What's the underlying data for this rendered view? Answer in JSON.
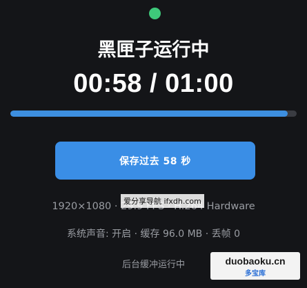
{
  "colors": {
    "background": "#141518",
    "status_dot": "#3ec97a",
    "progress_fill": "#3d8fe0",
    "progress_track": "#3a3c42",
    "button_bg": "#3a8ee6",
    "text_primary": "#ffffff",
    "text_secondary": "#9a9da3"
  },
  "icons": {
    "status": "status-dot-icon"
  },
  "status": {
    "title": "黑匣子运行中",
    "elapsed": "00:58",
    "separator": " / ",
    "total": "01:00",
    "progress": 0.968
  },
  "save_button": {
    "label": "保存过去 58 秒"
  },
  "info": {
    "video": "1920×1080 · 29.9 FPS · H.264 Hardware",
    "audio": "系统声音: 开启 · 缓存 96.0 MB · 丢帧 0"
  },
  "footer": {
    "background_status": "后台缓冲运行中"
  },
  "watermarks": {
    "center": "爱分享导航 ifxdh.com",
    "corner_main": "duobaoku.cn",
    "corner_sub": "多宝库"
  }
}
